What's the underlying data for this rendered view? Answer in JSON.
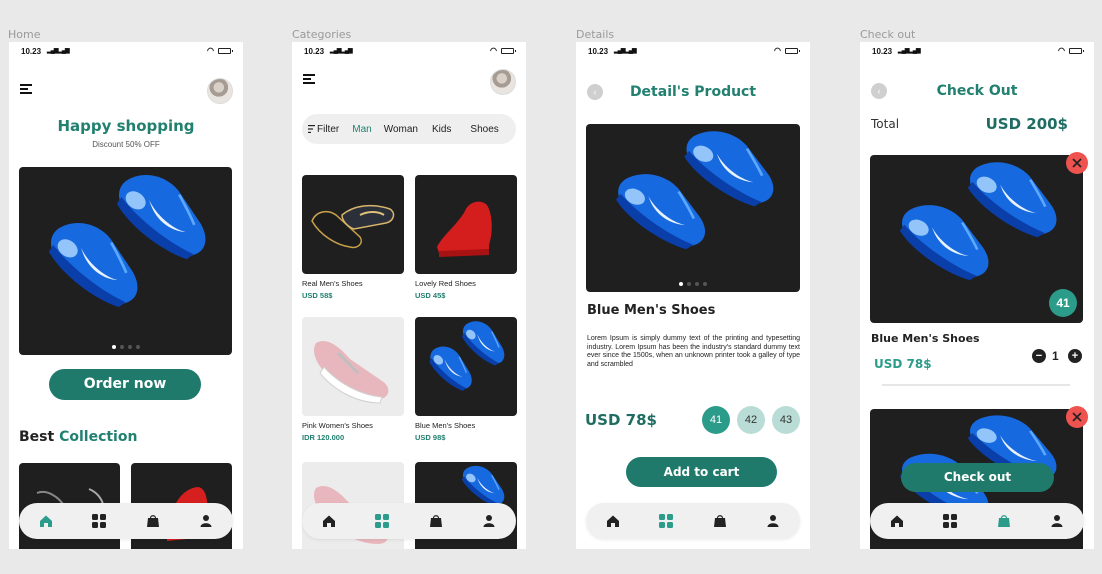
{
  "colors": {
    "accent": "#21806f",
    "button": "#1f7a6c",
    "size_active": "#2c9c8a",
    "size_idle": "#b9ddd6",
    "close": "#ef5350",
    "bg": "#e9e9e9"
  },
  "frames": [
    {
      "label": "Home"
    },
    {
      "label": "Categories"
    },
    {
      "label": "Details"
    },
    {
      "label": "Check out"
    }
  ],
  "status": {
    "time": "10.23"
  },
  "home": {
    "title": "Happy shopping",
    "subtitle": "Discount 50% OFF",
    "order_button": "Order now",
    "section_prefix": "Best ",
    "section_accent": "Collection",
    "carousel_dots": 4
  },
  "categories": {
    "filter_label": "Filter",
    "tabs": [
      {
        "label": "Man",
        "active": true
      },
      {
        "label": "Woman",
        "active": false
      },
      {
        "label": "Kids",
        "active": false
      },
      {
        "label": "Shoes",
        "active": false
      }
    ],
    "products": [
      {
        "name": "Real Men's Shoes",
        "price": "USD 58$",
        "image": "dark-sneakers"
      },
      {
        "name": "Lovely Red Shoes",
        "price": "USD 45$",
        "image": "red-boot"
      },
      {
        "name": "Pink Women's Shoes",
        "price": "IDR 120.000",
        "image": "pink-sneaker"
      },
      {
        "name": "Blue Men's Shoes",
        "price": "USD 98$",
        "image": "blue-cleats"
      }
    ]
  },
  "details": {
    "title": "Detail's Product",
    "product_name": "Blue Men's Shoes",
    "description": "Lorem Ipsum is simply dummy text of the printing and typesetting industry. Lorem Ipsum has been the industry's standard dummy text ever since the 1500s, when an unknown printer took a galley of type and scrambled",
    "price": "USD 78$",
    "sizes": [
      {
        "label": "41",
        "active": true
      },
      {
        "label": "42",
        "active": false
      },
      {
        "label": "43",
        "active": false
      }
    ],
    "add_to_cart": "Add to cart"
  },
  "checkout": {
    "title": "Check Out",
    "total_label": "Total",
    "total_value": "USD 200$",
    "item_name": "Blue Men's Shoes",
    "item_price": "USD 78$",
    "item_size": "41",
    "quantity": "1",
    "checkout_button": "Check out"
  },
  "nav": [
    {
      "icon": "home-icon"
    },
    {
      "icon": "grid-icon"
    },
    {
      "icon": "bag-icon"
    },
    {
      "icon": "user-icon"
    }
  ]
}
